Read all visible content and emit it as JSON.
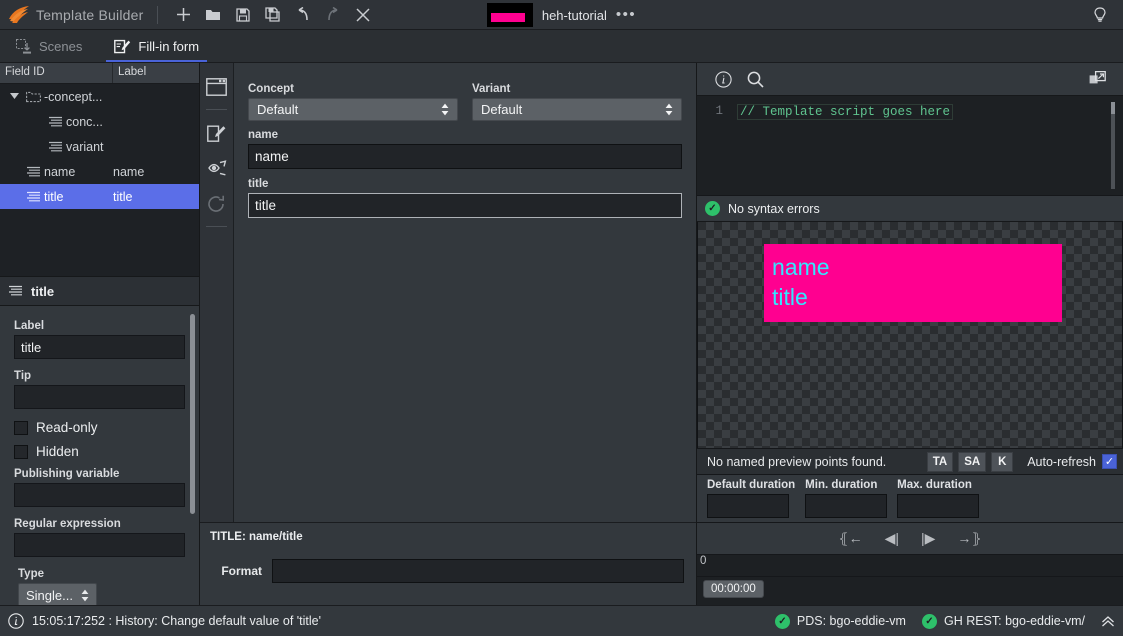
{
  "titlebar": {
    "logo_icon": "feather-logo-icon",
    "app_title": "Template Builder",
    "buttons": [
      {
        "name": "new-button",
        "icon": "plus-icon",
        "label": "+"
      },
      {
        "name": "open-button",
        "icon": "folder-open-icon",
        "label": ""
      },
      {
        "name": "save-button",
        "icon": "save-icon",
        "label": ""
      },
      {
        "name": "save-as-button",
        "icon": "save-as-icon",
        "label": ""
      },
      {
        "name": "undo-button",
        "icon": "undo-icon",
        "label": ""
      },
      {
        "name": "redo-button",
        "icon": "redo-icon",
        "label": ""
      },
      {
        "name": "close-button",
        "icon": "close-icon",
        "label": ""
      }
    ],
    "document": {
      "thumbnail_icon": "document-thumbnail",
      "name": "heh-tutorial",
      "more_label": "•••"
    },
    "help_icon": "lightbulb-icon"
  },
  "tabs": [
    {
      "label": "Scenes",
      "icon": "scenes-icon",
      "active": false
    },
    {
      "label": "Fill-in form",
      "icon": "fill-in-form-icon",
      "active": true
    }
  ],
  "tree": {
    "columns": [
      "Field ID",
      "Label"
    ],
    "rows": [
      {
        "id": "-concept...",
        "label": "",
        "icon": "folder-icon",
        "depth": 0,
        "expanded": true,
        "selected": false
      },
      {
        "id": "conc...",
        "label": "",
        "icon": "field-icon",
        "depth": 1,
        "expanded": false,
        "selected": false
      },
      {
        "id": "variant",
        "label": "",
        "icon": "field-icon",
        "depth": 1,
        "expanded": false,
        "selected": false
      },
      {
        "id": "name",
        "label": "name",
        "icon": "field-icon",
        "depth": 0,
        "expanded": false,
        "selected": false
      },
      {
        "id": "title",
        "label": "title",
        "icon": "field-icon",
        "depth": 0,
        "expanded": false,
        "selected": true
      }
    ]
  },
  "properties": {
    "header": {
      "icon": "field-icon",
      "title": "title"
    },
    "label_caption": "Label",
    "label_value": "title",
    "tip_caption": "Tip",
    "tip_value": "",
    "readonly_caption": "Read-only",
    "readonly_checked": false,
    "hidden_caption": "Hidden",
    "hidden_checked": false,
    "publishing_caption": "Publishing variable",
    "publishing_value": "",
    "regex_caption": "Regular expression",
    "regex_value": "",
    "type_caption": "Type",
    "type_value": "Single..."
  },
  "iconstrip": [
    {
      "name": "page-icon",
      "dim": false
    },
    {
      "name": "edit-icon",
      "dim": false
    },
    {
      "name": "preview-eye-icon",
      "dim": false
    },
    {
      "name": "refresh-icon",
      "dim": true
    }
  ],
  "form": {
    "concept_caption": "Concept",
    "concept_value": "Default",
    "variant_caption": "Variant",
    "variant_value": "Default",
    "name_caption": "name",
    "name_value": "name",
    "title_caption": "title",
    "title_value": "title"
  },
  "format_panel": {
    "title": "TITLE: name/title",
    "format_caption": "Format",
    "format_value": ""
  },
  "editor": {
    "info_icon": "info-icon",
    "search_icon": "search-icon",
    "popout_icon": "popout-window-icon",
    "line_number": "1",
    "code": "// Template script goes here",
    "status_text": "No syntax errors",
    "status_icon": "check-circle-icon"
  },
  "preview": {
    "graphic_line1": "name",
    "graphic_line2": "title",
    "graphic_bg_color": "#ff0090",
    "graphic_text_color": "#33e6ff",
    "points_text": "No named preview points found.",
    "mini_buttons": [
      "TA",
      "SA",
      "K"
    ],
    "autorefresh_label": "Auto-refresh",
    "autorefresh_checked": true,
    "durations": [
      {
        "caption": "Default duration",
        "value": ""
      },
      {
        "caption": "Min. duration",
        "value": ""
      },
      {
        "caption": "Max. duration",
        "value": ""
      }
    ],
    "transport": [
      {
        "name": "jump-to-start-button",
        "glyph": "⦃←"
      },
      {
        "name": "step-back-button",
        "glyph": "◀|"
      },
      {
        "name": "step-forward-button",
        "glyph": "|▶"
      },
      {
        "name": "jump-to-end-button",
        "glyph": "→⦄"
      }
    ],
    "ruler_start": "0",
    "timecode": "00:00:00"
  },
  "statusbar": {
    "info_icon": "info-icon",
    "message": "15:05:17:252 : History: Change default value of 'title'",
    "connections": [
      {
        "icon": "check-circle-icon",
        "label": "PDS: bgo-eddie-vm"
      },
      {
        "icon": "check-circle-icon",
        "label": "GH REST: bgo-eddie-vm/"
      }
    ],
    "expand_icon": "chevron-up-icon"
  },
  "colors": {
    "accent_blue": "#4a63d8",
    "selection_blue": "#5b6ee8",
    "status_green": "#2ec06a",
    "logo_orange": "#e8761f",
    "magenta": "#ff0090",
    "cyan": "#33e6ff"
  }
}
